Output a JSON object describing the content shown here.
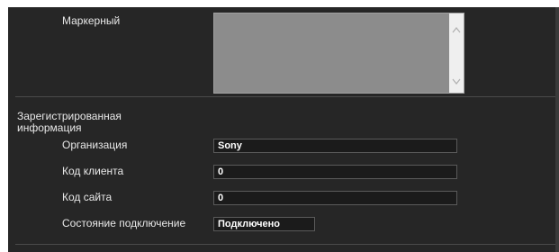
{
  "form": {
    "marker_label": "Маркерный",
    "section_title": "Зарегистрированная информация",
    "rows": [
      {
        "label": "Организация",
        "value": "Sony"
      },
      {
        "label": "Код клиента",
        "value": "0"
      },
      {
        "label": "Код сайта",
        "value": "0"
      },
      {
        "label": "Состояние подключение",
        "value": "Подключено"
      }
    ]
  },
  "icons": {
    "scroll_up": "chevron-up-icon",
    "scroll_down": "chevron-down-icon"
  },
  "colors": {
    "panel_bg": "#262626",
    "field_bg": "#1b1b1b",
    "textarea_bg": "#8c8c8c",
    "text": "#e8e8e8"
  }
}
